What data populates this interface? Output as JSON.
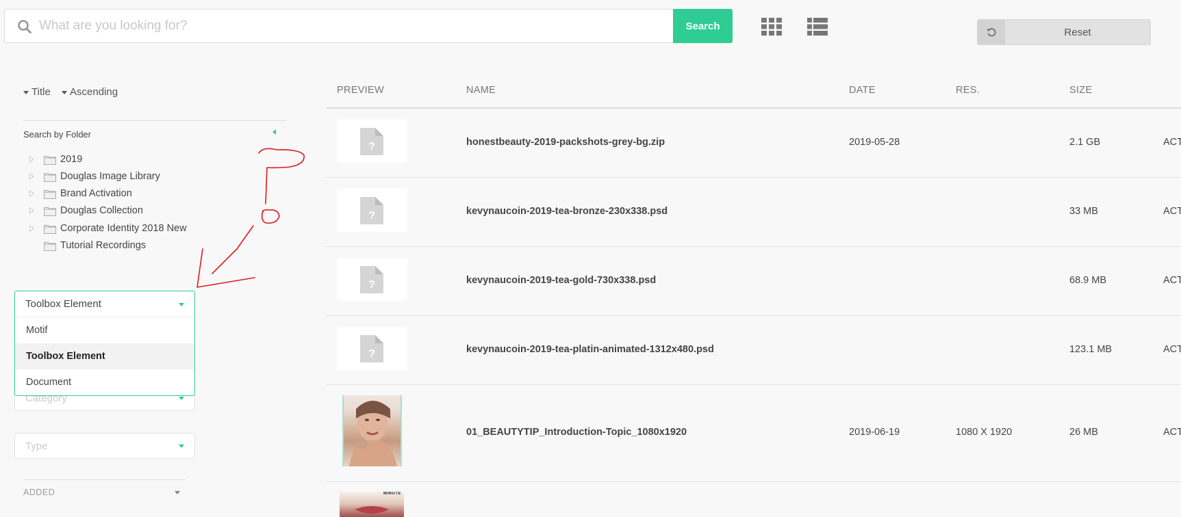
{
  "search": {
    "placeholder": "What are you looking for?",
    "value": "",
    "button_label": "Search"
  },
  "toolbar": {
    "grid_view_icon": "grid-icon",
    "list_view_icon": "list-icon",
    "reset_label": "Reset"
  },
  "sort": {
    "field_label": "Title",
    "order_label": "Ascending"
  },
  "sidebar": {
    "folder_title": "Search by Folder",
    "folders": [
      {
        "label": "2019",
        "expandable": true
      },
      {
        "label": "Douglas Image Library",
        "expandable": true
      },
      {
        "label": "Brand Activation",
        "expandable": true
      },
      {
        "label": "Douglas Collection",
        "expandable": true
      },
      {
        "label": "Corporate Identity 2018 New",
        "expandable": true
      },
      {
        "label": "Tutorial Recordings",
        "expandable": false
      }
    ],
    "dropdown_open": {
      "selected": "Toolbox Element",
      "options": [
        "Motif",
        "Toolbox Element",
        "Document"
      ]
    },
    "category_placeholder": "Category",
    "type_placeholder": "Type",
    "added_label": "ADDED"
  },
  "table": {
    "headers": {
      "preview": "PREVIEW",
      "name": "NAME",
      "date": "DATE",
      "res": "RES.",
      "size": "SIZE"
    },
    "rows": [
      {
        "name": "honestbeauty-2019-packshots-grey-bg.zip",
        "date": "2019-05-28",
        "res": "",
        "size": "2.1 GB",
        "status": "ACT"
      },
      {
        "name": "kevynaucoin-2019-tea-bronze-230x338.psd",
        "date": "",
        "res": "",
        "size": "33 MB",
        "status": "ACT"
      },
      {
        "name": "kevynaucoin-2019-tea-gold-730x338.psd",
        "date": "",
        "res": "",
        "size": "68.9 MB",
        "status": "ACT"
      },
      {
        "name": "kevynaucoin-2019-tea-platin-animated-1312x480.psd",
        "date": "",
        "res": "",
        "size": "123.1 MB",
        "status": "ACT"
      },
      {
        "name": "01_BEAUTYTIP_Introduction-Topic_1080x1920",
        "date": "2019-06-19",
        "res": "1080 X 1920",
        "size": "26 MB",
        "status": "ACT"
      }
    ],
    "partial_thumb_text": "MINUTE"
  },
  "colors": {
    "accent": "#2fcc94",
    "annotation": "#e0191c"
  }
}
